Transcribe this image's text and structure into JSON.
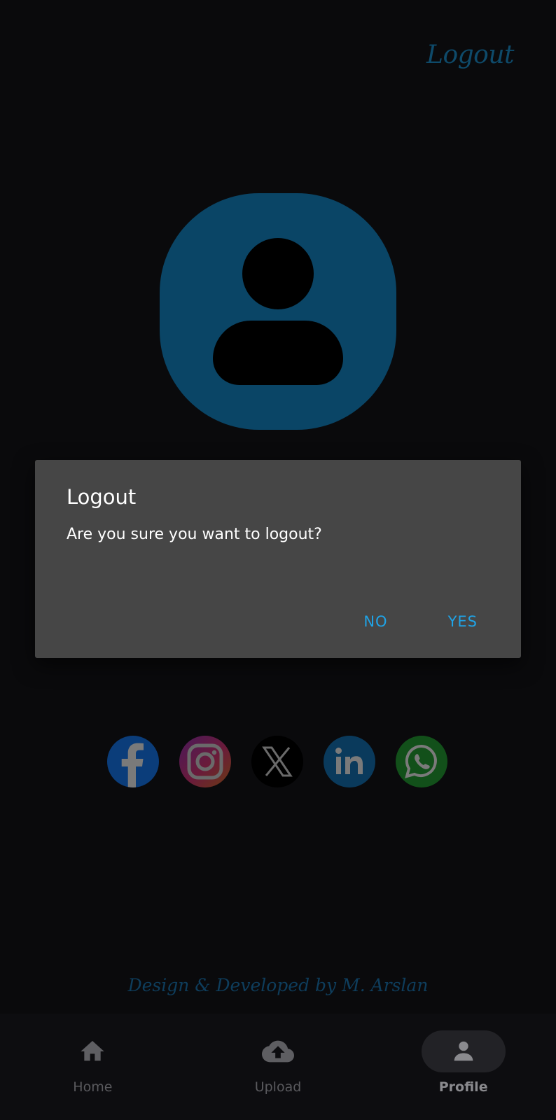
{
  "header": {
    "logout_label": "Logout"
  },
  "social": [
    {
      "name": "facebook",
      "icon": "facebook-icon"
    },
    {
      "name": "instagram",
      "icon": "instagram-icon"
    },
    {
      "name": "x",
      "icon": "x-icon"
    },
    {
      "name": "linkedin",
      "icon": "linkedin-icon"
    },
    {
      "name": "whatsapp",
      "icon": "whatsapp-icon"
    }
  ],
  "footer": {
    "credit": "Design & Developed by M. Arslan"
  },
  "nav": {
    "items": [
      {
        "label": "Home",
        "icon": "home-icon",
        "active": false
      },
      {
        "label": "Upload",
        "icon": "cloud-upload-icon",
        "active": false
      },
      {
        "label": "Profile",
        "icon": "person-icon",
        "active": true
      }
    ]
  },
  "dialog": {
    "title": "Logout",
    "message": "Are you sure you want to logout?",
    "no_label": "NO",
    "yes_label": "YES"
  },
  "colors": {
    "accent": "#1fa3e6",
    "avatar_bg": "#0a4566",
    "background": "#0a0a0c",
    "dialog_bg": "#464646"
  }
}
